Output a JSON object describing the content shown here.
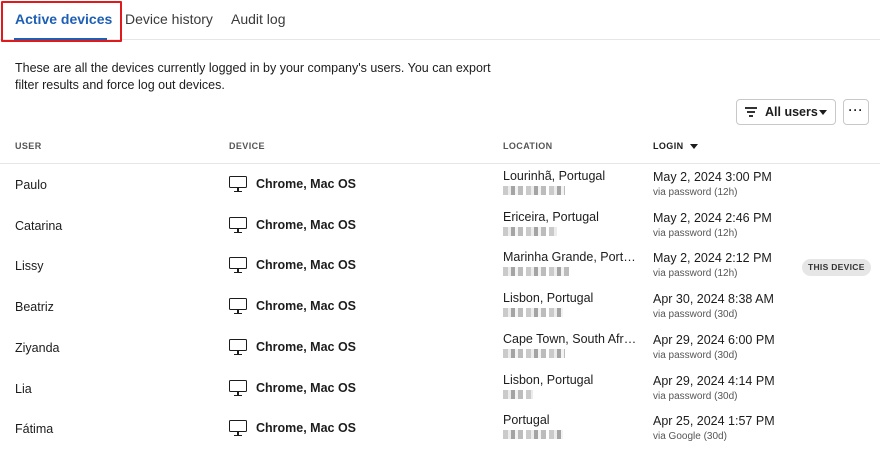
{
  "tabs": [
    {
      "label": "Active devices",
      "active": true
    },
    {
      "label": "Device history",
      "active": false
    },
    {
      "label": "Audit log",
      "active": false
    }
  ],
  "description": "These are all the devices currently logged in by your company's users. You can export filter results and force log out devices.",
  "toolbar": {
    "filter_label": "All users",
    "more_label": "···"
  },
  "columns": {
    "user": "USER",
    "device": "DEVICE",
    "location": "LOCATION",
    "login": "LOGIN"
  },
  "rows": [
    {
      "user": "Paulo",
      "device": "Chrome, Mac OS",
      "location": "Lourinhã, Portugal",
      "login_date": "May 2, 2024 3:00 PM",
      "login_method": "via password (12h)",
      "badge": ""
    },
    {
      "user": "Catarina",
      "device": "Chrome, Mac OS",
      "location": "Ericeira, Portugal",
      "login_date": "May 2, 2024 2:46 PM",
      "login_method": "via password (12h)",
      "badge": ""
    },
    {
      "user": "Lissy",
      "device": "Chrome, Mac OS",
      "location": "Marinha Grande, Portu...",
      "login_date": "May 2, 2024 2:12 PM",
      "login_method": "via password (12h)",
      "badge": "THIS DEVICE"
    },
    {
      "user": "Beatriz",
      "device": "Chrome, Mac OS",
      "location": "Lisbon, Portugal",
      "login_date": "Apr 30, 2024 8:38 AM",
      "login_method": "via password (30d)",
      "badge": ""
    },
    {
      "user": "Ziyanda",
      "device": "Chrome, Mac OS",
      "location": "Cape Town, South Africa",
      "login_date": "Apr 29, 2024 6:00 PM",
      "login_method": "via password (30d)",
      "badge": ""
    },
    {
      "user": "Lia",
      "device": "Chrome, Mac OS",
      "location": "Lisbon, Portugal",
      "login_date": "Apr 29, 2024 4:14 PM",
      "login_method": "via password (30d)",
      "badge": ""
    },
    {
      "user": "Fátima",
      "device": "Chrome, Mac OS",
      "location": "Portugal",
      "login_date": "Apr 25, 2024 1:57 PM",
      "login_method": "via Google (30d)",
      "badge": ""
    }
  ],
  "colors": {
    "accent": "#1d5fb4",
    "highlight": "#e0191c",
    "badge_bg": "#e6e6e6"
  }
}
